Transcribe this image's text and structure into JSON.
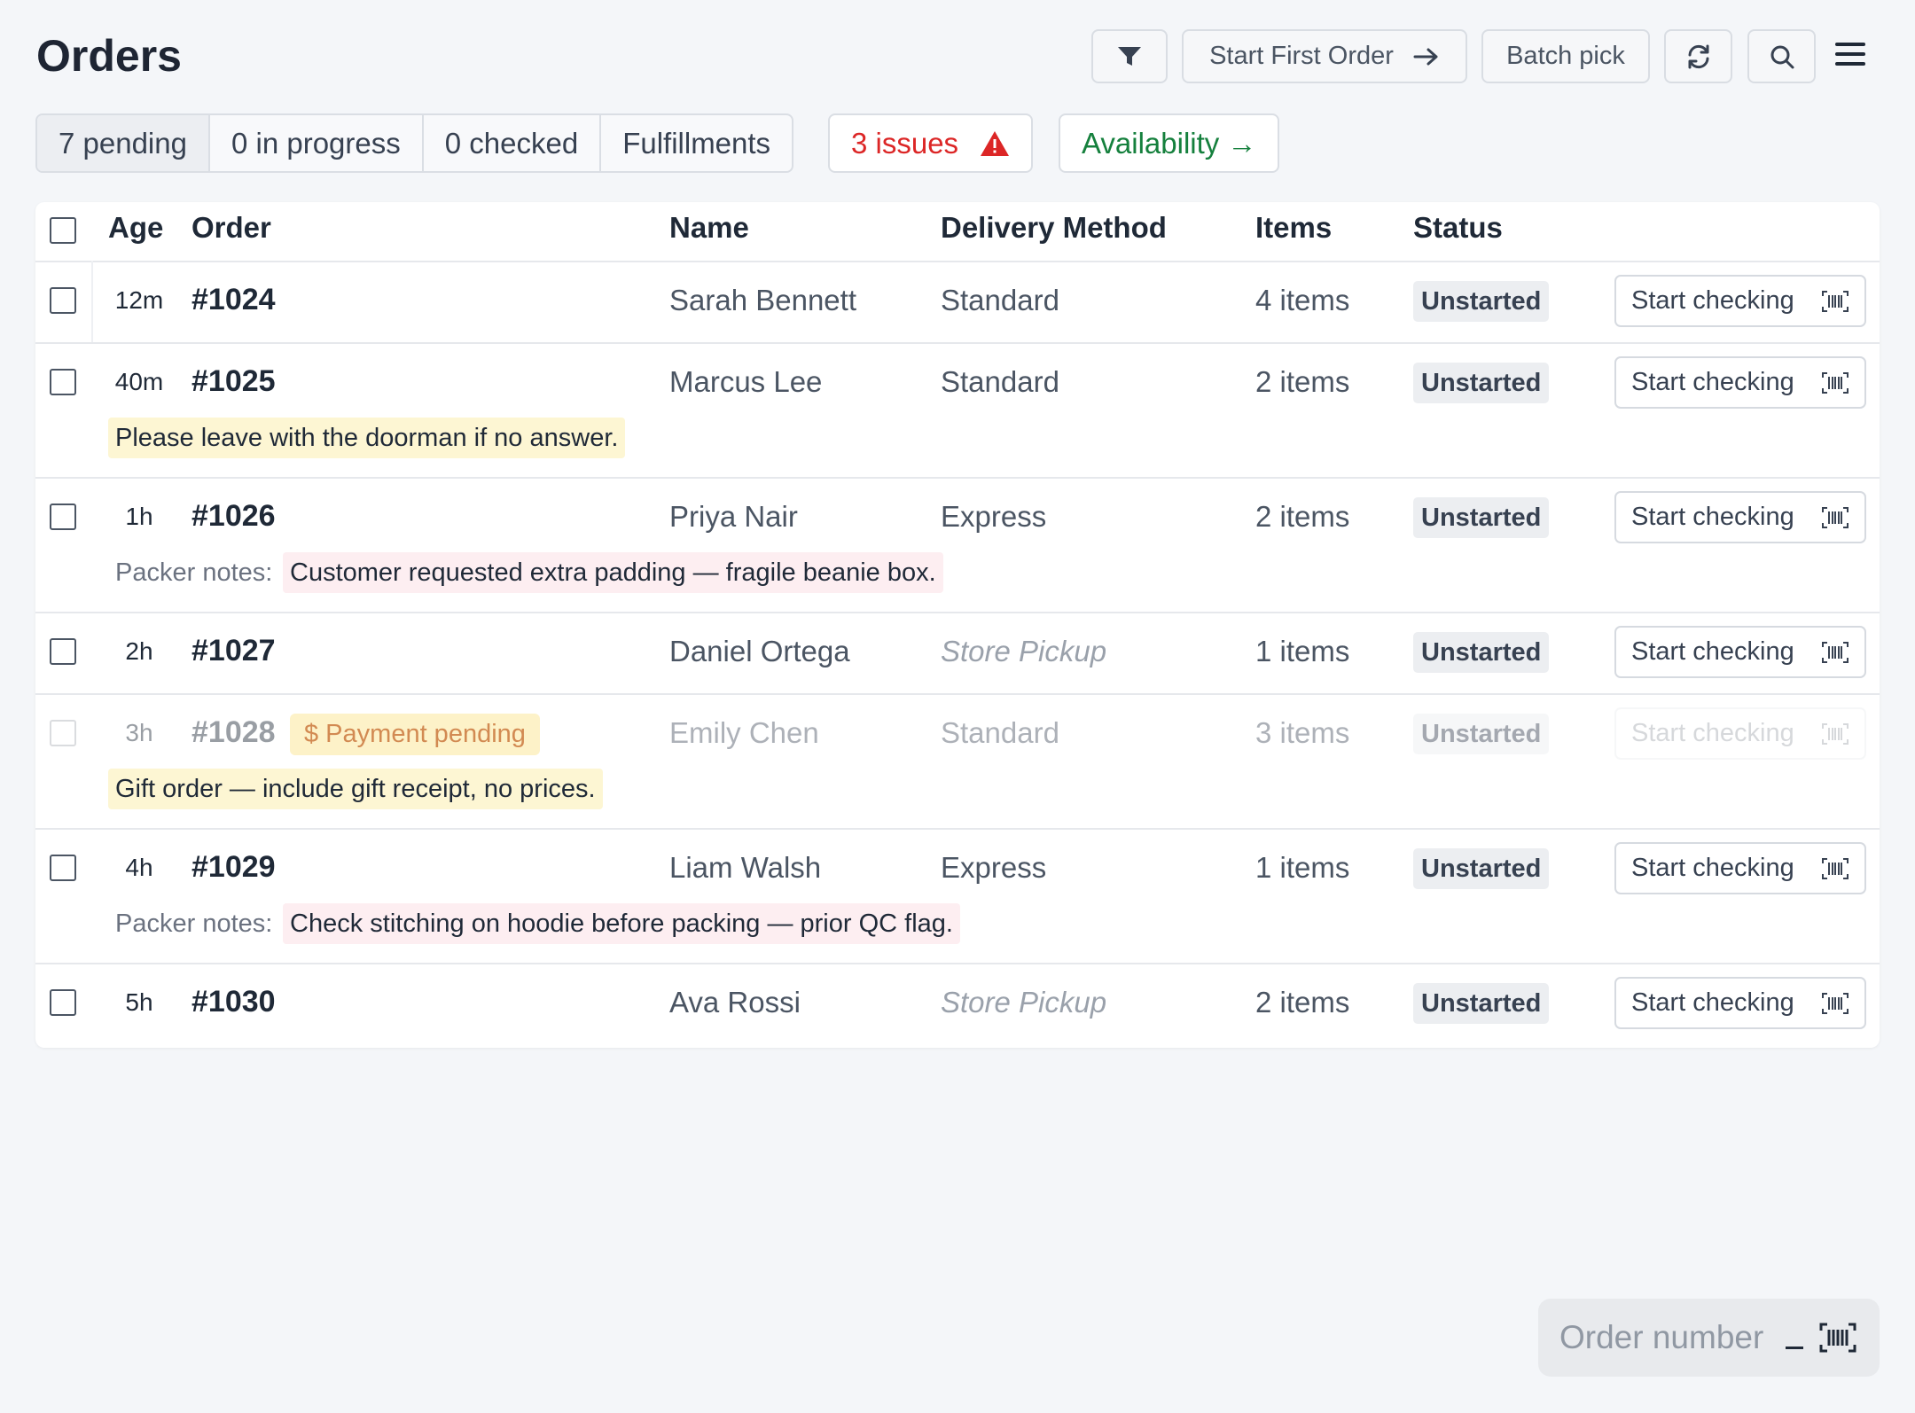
{
  "page": {
    "title": "Orders"
  },
  "toolbar": {
    "start_first_order": "Start First Order",
    "batch_pick": "Batch pick"
  },
  "tabs": [
    {
      "label": "7 pending"
    },
    {
      "label": "0 in progress"
    },
    {
      "label": "0 checked"
    },
    {
      "label": "Fulfillments"
    }
  ],
  "issues_label": "3 issues",
  "availability_label": "Availability →",
  "table": {
    "columns": {
      "age": "Age",
      "order": "Order",
      "name": "Name",
      "delivery": "Delivery Method",
      "items": "Items",
      "status": "Status"
    },
    "rows": [
      {
        "age": "12m",
        "order": "#1024",
        "name": "Sarah Bennett",
        "delivery": "Standard",
        "items": "4 items",
        "status": "Unstarted",
        "action": "Start checking"
      },
      {
        "age": "40m",
        "order": "#1025",
        "name": "Marcus Lee",
        "delivery": "Standard",
        "items": "2 items",
        "status": "Unstarted",
        "action": "Start checking",
        "note": "Please leave with the doorman if no answer."
      },
      {
        "age": "1h",
        "order": "#1026",
        "name": "Priya Nair",
        "delivery": "Express",
        "items": "2 items",
        "status": "Unstarted",
        "action": "Start checking",
        "packer_label": "Packer notes:",
        "packer_note": "Customer requested extra padding — fragile beanie box."
      },
      {
        "age": "2h",
        "order": "#1027",
        "name": "Daniel Ortega",
        "delivery": "Store Pickup",
        "items": "1 items",
        "status": "Unstarted",
        "action": "Start checking"
      },
      {
        "age": "3h",
        "order": "#1028",
        "tag": "$ Payment pending",
        "name": "Emily Chen",
        "delivery": "Standard",
        "items": "3 items",
        "status": "Unstarted",
        "action": "Start checking",
        "note": "Gift order — include gift receipt, no prices."
      },
      {
        "age": "4h",
        "order": "#1029",
        "name": "Liam Walsh",
        "delivery": "Express",
        "items": "1 items",
        "status": "Unstarted",
        "action": "Start checking",
        "packer_label": "Packer notes:",
        "packer_note": "Check stitching on hoodie before packing — prior QC flag."
      },
      {
        "age": "5h",
        "order": "#1030",
        "name": "Ava Rossi",
        "delivery": "Store Pickup",
        "items": "2 items",
        "status": "Unstarted",
        "action": "Start checking"
      }
    ]
  },
  "order_input": {
    "placeholder": "Order number"
  },
  "colors": {
    "issues": "#dc2626",
    "availability": "#15803d",
    "note_yellow": "#fdf6d3",
    "note_pink": "#fdeef1"
  }
}
